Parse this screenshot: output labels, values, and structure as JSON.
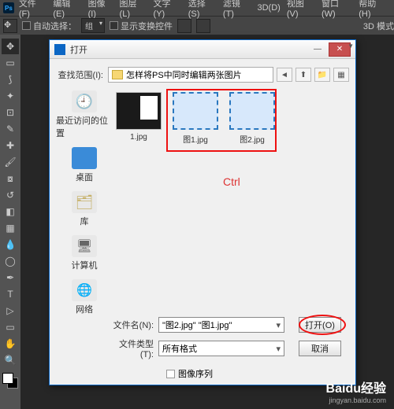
{
  "menubar": {
    "items": [
      "文件(F)",
      "编辑(E)",
      "图像(I)",
      "图层(L)",
      "文字(Y)",
      "选择(S)",
      "滤镜(T)",
      "3D(D)",
      "视图(V)",
      "窗口(W)",
      "帮助(H)"
    ]
  },
  "optbar": {
    "auto_select": "自动选择：",
    "group": "组",
    "show_transform": "显示变换控件",
    "mode3d": "3D 模式"
  },
  "dialog": {
    "title": "打开",
    "lookin_label": "查找范围(I):",
    "folder": "怎样将PS中同时编辑两张图片",
    "places": {
      "recent": "最近访问的位置",
      "desktop": "桌面",
      "library": "库",
      "computer": "计算机",
      "network": "网络"
    },
    "thumbs": [
      {
        "label": "1.jpg"
      },
      {
        "label": "图1.jpg"
      },
      {
        "label": "图2.jpg"
      }
    ],
    "annotation": "Ctrl",
    "filename_label": "文件名(N):",
    "filename_value": "\"图2.jpg\" \"图1.jpg\"",
    "filetype_label": "文件类型(T):",
    "filetype_value": "所有格式",
    "open_btn": "打开(O)",
    "cancel_btn": "取消",
    "image_seq": "图像序列"
  },
  "watermark": {
    "brand": "Baidu经验",
    "url": "jingyan.baidu.com"
  }
}
